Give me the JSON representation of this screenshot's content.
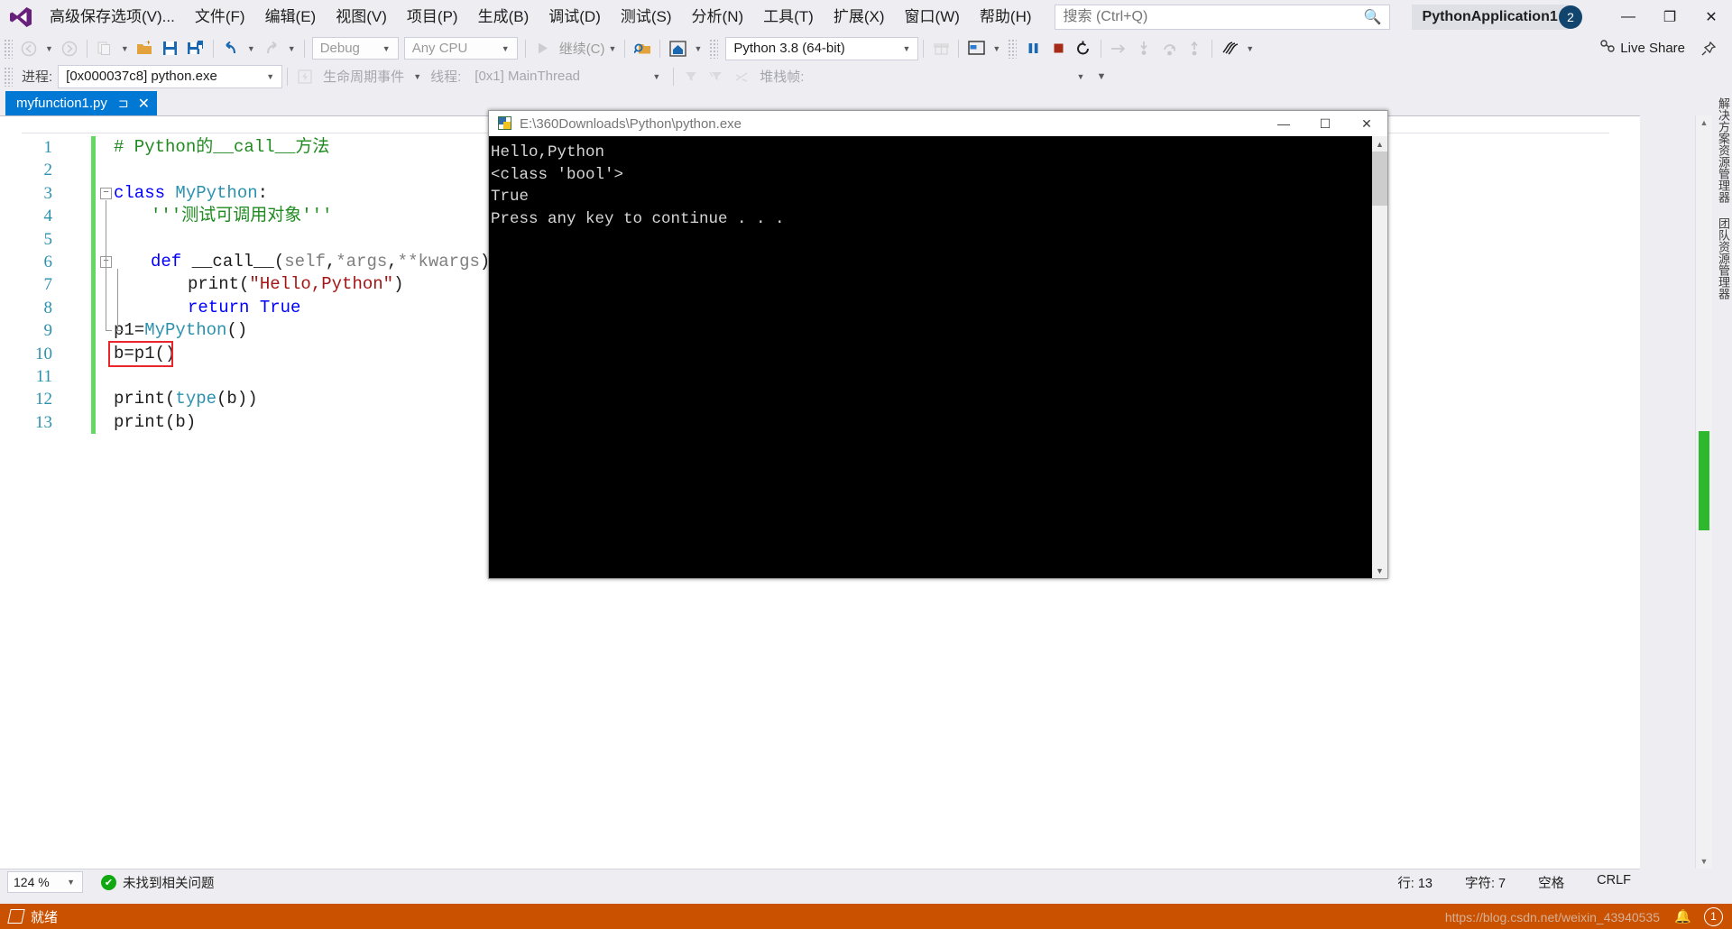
{
  "app": {
    "logo_icon": "visual-studio-logo",
    "project_badge": "PythonApplication1",
    "notification_count": "2"
  },
  "menu": {
    "items": [
      {
        "label": "高级保存选项(V)..."
      },
      {
        "label": "文件(F)"
      },
      {
        "label": "编辑(E)"
      },
      {
        "label": "视图(V)"
      },
      {
        "label": "项目(P)"
      },
      {
        "label": "生成(B)"
      },
      {
        "label": "调试(D)"
      },
      {
        "label": "测试(S)"
      },
      {
        "label": "分析(N)"
      },
      {
        "label": "工具(T)"
      },
      {
        "label": "扩展(X)"
      },
      {
        "label": "窗口(W)"
      },
      {
        "label": "帮助(H)"
      }
    ]
  },
  "search": {
    "placeholder": "搜索 (Ctrl+Q)",
    "value": "",
    "icon": "search-icon"
  },
  "window_controls": {
    "minimize": "—",
    "restore": "❐",
    "close": "✕"
  },
  "toolbar": {
    "nav_back_icon": "navigate-back-icon",
    "nav_forward_icon": "navigate-forward-icon",
    "new_item_icon": "new-item-icon",
    "open_icon": "open-folder-icon",
    "save_icon": "save-icon",
    "save_all_icon": "save-all-icon",
    "undo_icon": "undo-icon",
    "redo_icon": "redo-icon",
    "configuration": "Debug",
    "platform": "Any CPU",
    "start_icon": "play-icon",
    "start_label": "继续(C)",
    "find_icon": "find-in-files-icon",
    "home_icon": "home-icon",
    "gift_icon": "gift-icon",
    "layout_icon": "window-layout-icon",
    "break_all_icon": "pause-icon",
    "stop_icon": "stop-icon",
    "restart_icon": "restart-icon",
    "show_next_statement_icon": "show-next-statement-icon",
    "step_into_icon": "step-into-icon",
    "step_over_icon": "step-over-icon",
    "step_out_icon": "step-out-icon",
    "threads_icon": "threads-icon"
  },
  "debug_toolbar": {
    "process_label": "进程:",
    "process_value": "[0x000037c8] python.exe",
    "lifecycle_icon": "lifecycle-events-icon",
    "lifecycle_label": "生命周期事件",
    "thread_label": "线程:",
    "thread_value": "[0x1] MainThread",
    "filter_icon": "filter-icon",
    "filter_down_icon": "filter-down-icon",
    "shuffle_icon": "shuffle-icon",
    "stackframe_label": "堆栈帧:",
    "stackframe_value": ""
  },
  "tab": {
    "label": "myfunction1.py",
    "pin_icon": "pin-icon",
    "close_icon": "close-icon"
  },
  "editor": {
    "lines": [
      {
        "num": "1",
        "indent": 0,
        "fold": "",
        "tokens": [
          {
            "t": "# Python的__call__方法",
            "c": "cm"
          }
        ]
      },
      {
        "num": "2",
        "indent": 0,
        "fold": "",
        "tokens": []
      },
      {
        "num": "3",
        "indent": 0,
        "fold": "minus",
        "tokens": [
          {
            "t": "class ",
            "c": "kw"
          },
          {
            "t": "MyPython",
            "c": "cls"
          },
          {
            "t": ":",
            "c": "pl"
          }
        ]
      },
      {
        "num": "4",
        "indent": 1,
        "fold": "",
        "tokens": [
          {
            "t": "'''测试可调用对象'''",
            "c": "cm"
          }
        ]
      },
      {
        "num": "5",
        "indent": 0,
        "fold": "",
        "tokens": []
      },
      {
        "num": "6",
        "indent": 1,
        "fold": "minus",
        "tokens": [
          {
            "t": "def ",
            "c": "kw"
          },
          {
            "t": "__call__",
            "c": "pl"
          },
          {
            "t": "(",
            "c": "pl"
          },
          {
            "t": "self",
            "c": "par"
          },
          {
            "t": ",",
            "c": "pl"
          },
          {
            "t": "*args",
            "c": "par"
          },
          {
            "t": ",",
            "c": "pl"
          },
          {
            "t": "**kwargs",
            "c": "par"
          },
          {
            "t": "):",
            "c": "pl"
          }
        ]
      },
      {
        "num": "7",
        "indent": 2,
        "fold": "",
        "tokens": [
          {
            "t": "print",
            "c": "pl"
          },
          {
            "t": "(",
            "c": "pl"
          },
          {
            "t": "\"Hello,Python\"",
            "c": "str"
          },
          {
            "t": ")",
            "c": "pl"
          }
        ]
      },
      {
        "num": "8",
        "indent": 2,
        "fold": "",
        "tokens": [
          {
            "t": "return ",
            "c": "kw"
          },
          {
            "t": "True",
            "c": "kw"
          }
        ]
      },
      {
        "num": "9",
        "indent": 0,
        "fold": "",
        "tokens": [
          {
            "t": "p1=",
            "c": "pl"
          },
          {
            "t": "MyPython",
            "c": "cls"
          },
          {
            "t": "()",
            "c": "pl"
          }
        ]
      },
      {
        "num": "10",
        "indent": 0,
        "fold": "",
        "highlight": true,
        "tokens": [
          {
            "t": "b=p1()",
            "c": "pl"
          }
        ]
      },
      {
        "num": "11",
        "indent": 0,
        "fold": "",
        "tokens": []
      },
      {
        "num": "12",
        "indent": 0,
        "fold": "",
        "tokens": [
          {
            "t": "print",
            "c": "pl"
          },
          {
            "t": "(",
            "c": "pl"
          },
          {
            "t": "type",
            "c": "cls"
          },
          {
            "t": "(b))",
            "c": "pl"
          }
        ]
      },
      {
        "num": "13",
        "indent": 0,
        "fold": "",
        "tokens": [
          {
            "t": "print(b)",
            "c": "pl"
          }
        ]
      }
    ]
  },
  "console": {
    "title": "E:\\360Downloads\\Python\\python.exe",
    "icon": "python-exe-icon",
    "minimize": "—",
    "maximize": "☐",
    "close": "✕",
    "output": "Hello,Python\n<class 'bool'>\nTrue\nPress any key to continue . . ."
  },
  "right_dock": {
    "items": [
      {
        "label": "解决方案资源管理器"
      },
      {
        "label": "团队资源管理器"
      }
    ]
  },
  "zoombar": {
    "zoom": "124 %",
    "issue_icon": "check-circle-icon",
    "issue_text": "未找到相关问题",
    "line": "行: 13",
    "column": "字符: 7",
    "spaces": "空格",
    "eol": "CRLF"
  },
  "statusbar": {
    "icon": "ready-icon",
    "text": "就绪",
    "watermark": "https://blog.csdn.net/weixin_43940535",
    "notify_icon": "bell-icon",
    "notify_count": "1"
  },
  "liveshare": {
    "icon": "live-share-icon",
    "label": "Live Share",
    "pin_icon": "pin-icon"
  },
  "colors": {
    "accent": "#0078d4",
    "status_bar": "#ca5100",
    "change_bar": "#63d863",
    "highlight_box": "#e8262b",
    "badge": "#12456e"
  }
}
